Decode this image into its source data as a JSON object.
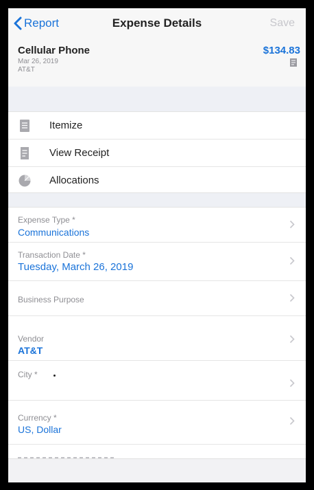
{
  "navbar": {
    "back_label": "Report",
    "title": "Expense Details",
    "save_label": "Save"
  },
  "summary": {
    "name": "Cellular Phone",
    "date": "Mar 26, 2019",
    "vendor": "AT&T",
    "amount": "$134.83"
  },
  "actions": [
    {
      "label": "Itemize",
      "icon": "itemize-icon"
    },
    {
      "label": "View Receipt",
      "icon": "receipt-icon"
    },
    {
      "label": "Allocations",
      "icon": "pie-chart-icon"
    }
  ],
  "fields": [
    {
      "label": "Expense Type *",
      "value": "Communications"
    },
    {
      "label": "Transaction Date *",
      "value": "Tuesday, March 26, 2019"
    },
    {
      "label": "Business Purpose",
      "value": ""
    },
    {
      "label": "Vendor",
      "value": "AT&T"
    },
    {
      "label": "City *",
      "value": ""
    },
    {
      "label": "Currency *",
      "value": "US, Dollar"
    }
  ],
  "colors": {
    "accent": "#1a73d9",
    "muted": "#8e8e93",
    "disabled": "#c7c7cc",
    "section_background": "#eef0f5"
  }
}
